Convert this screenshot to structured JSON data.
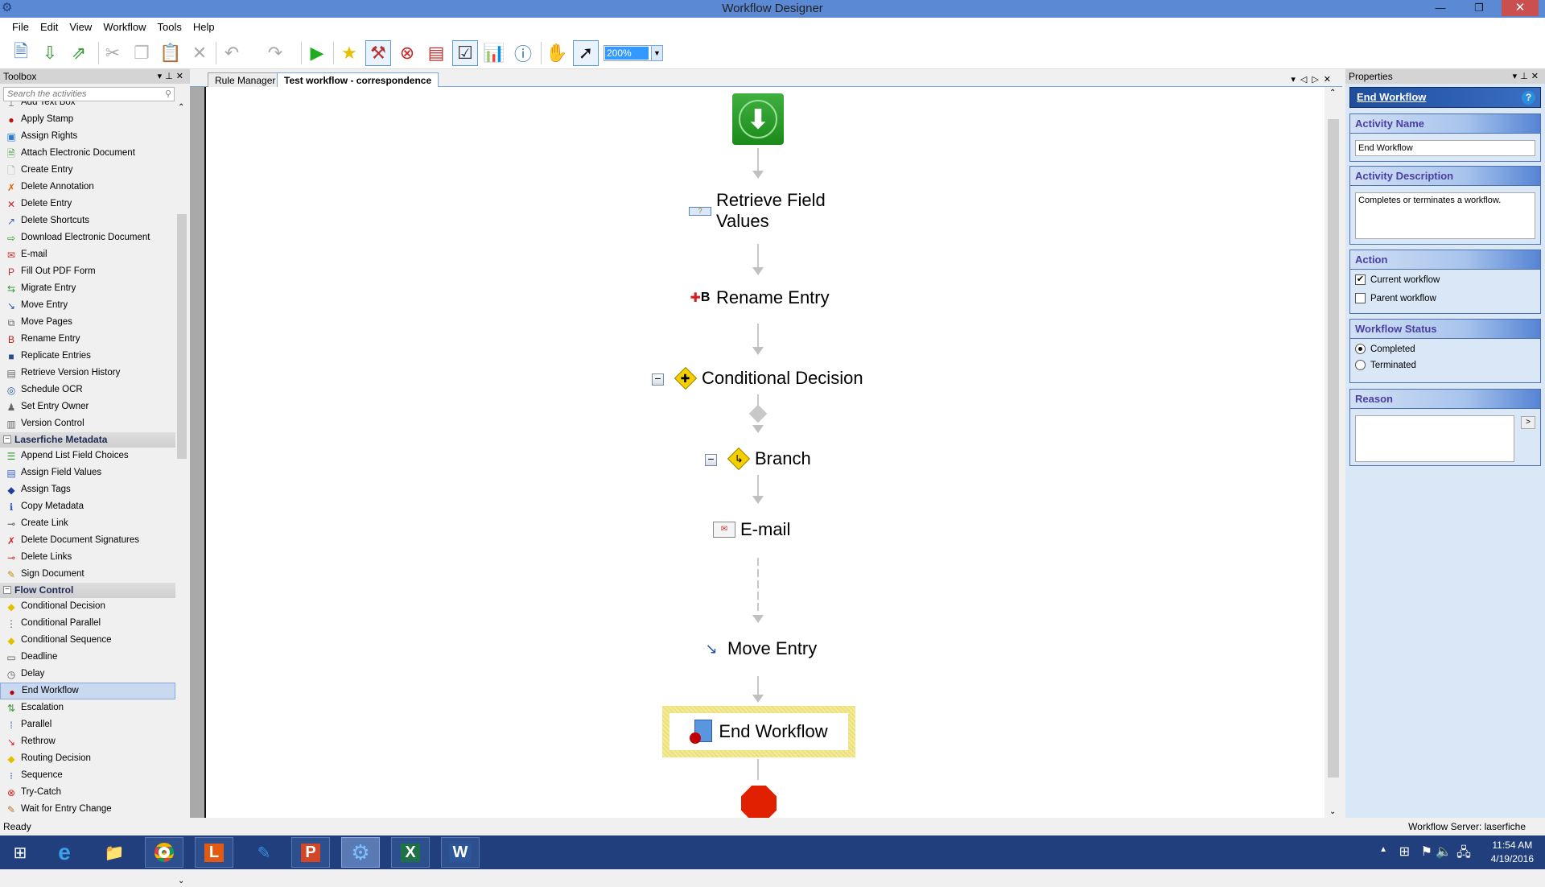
{
  "window": {
    "title": "Workflow Designer",
    "controls": {
      "minimize": "—",
      "restore": "❐",
      "close": "✕"
    }
  },
  "menu": [
    "File",
    "Edit",
    "View",
    "Workflow",
    "Tools",
    "Help"
  ],
  "toolbar": {
    "buttons": [
      {
        "name": "new-workflow",
        "icon": "new-workflow-icon"
      },
      {
        "name": "open-workflow",
        "icon": "open-workflow-icon"
      },
      {
        "name": "publish-workflow",
        "icon": "publish-workflow-icon"
      },
      {
        "name": "cut",
        "icon": "scissors-icon"
      },
      {
        "name": "copy",
        "icon": "copy-icon"
      },
      {
        "name": "paste",
        "icon": "paste-icon"
      },
      {
        "name": "delete",
        "icon": "delete-icon"
      },
      {
        "name": "undo",
        "icon": "undo-icon"
      },
      {
        "name": "redo",
        "icon": "redo-icon"
      },
      {
        "name": "run",
        "icon": "play-icon"
      },
      {
        "name": "find-starting-rules",
        "icon": "search-star-icon"
      },
      {
        "name": "tools",
        "icon": "tools-icon"
      },
      {
        "name": "errors",
        "icon": "error-icon"
      },
      {
        "name": "outline",
        "icon": "outline-icon"
      },
      {
        "name": "checklist",
        "icon": "checklist-icon"
      },
      {
        "name": "reports",
        "icon": "bar-chart-icon"
      },
      {
        "name": "workflow-info",
        "icon": "info-icon"
      },
      {
        "name": "pan",
        "icon": "hand-icon"
      },
      {
        "name": "select",
        "icon": "pointer-icon"
      }
    ],
    "zoom": "200%"
  },
  "toolbox": {
    "title": "Toolbox",
    "search_placeholder": "Search the activities",
    "items_top": [
      {
        "label": "Add Text Box",
        "icon": "text-box-icon"
      },
      {
        "label": "Apply Stamp",
        "icon": "stamp-icon"
      },
      {
        "label": "Assign Rights",
        "icon": "rights-icon"
      },
      {
        "label": "Attach Electronic Document",
        "icon": "attach-doc-icon"
      },
      {
        "label": "Create Entry",
        "icon": "new-entry-icon"
      },
      {
        "label": "Delete Annotation",
        "icon": "delete-annotation-icon"
      },
      {
        "label": "Delete Entry",
        "icon": "red-x-icon"
      },
      {
        "label": "Delete Shortcuts",
        "icon": "delete-shortcut-icon"
      },
      {
        "label": "Download Electronic Document",
        "icon": "download-doc-icon"
      },
      {
        "label": "E-mail",
        "icon": "email-icon"
      },
      {
        "label": "Fill Out PDF Form",
        "icon": "pdf-icon"
      },
      {
        "label": "Migrate Entry",
        "icon": "migrate-icon"
      },
      {
        "label": "Move Entry",
        "icon": "move-entry-icon"
      },
      {
        "label": "Move Pages",
        "icon": "move-pages-icon"
      },
      {
        "label": "Rename Entry",
        "icon": "rename-icon"
      },
      {
        "label": "Replicate Entries",
        "icon": "replicate-icon"
      },
      {
        "label": "Retrieve Version History",
        "icon": "version-history-icon"
      },
      {
        "label": "Schedule OCR",
        "icon": "ocr-icon"
      },
      {
        "label": "Set Entry Owner",
        "icon": "owner-icon"
      },
      {
        "label": "Version Control",
        "icon": "version-control-icon"
      }
    ],
    "cat_metadata": "Laserfiche Metadata",
    "items_metadata": [
      {
        "label": "Append List Field Choices",
        "icon": "list-append-icon"
      },
      {
        "label": "Assign Field Values",
        "icon": "field-values-icon"
      },
      {
        "label": "Assign Tags",
        "icon": "tag-icon"
      },
      {
        "label": "Copy Metadata",
        "icon": "copy-metadata-icon"
      },
      {
        "label": "Create Link",
        "icon": "link-icon"
      },
      {
        "label": "Delete Document Signatures",
        "icon": "delete-signature-icon"
      },
      {
        "label": "Delete Links",
        "icon": "delete-link-icon"
      },
      {
        "label": "Sign Document",
        "icon": "sign-icon"
      }
    ],
    "cat_flow": "Flow Control",
    "items_flow": [
      {
        "label": "Conditional Decision",
        "icon": "decision-icon"
      },
      {
        "label": "Conditional Parallel",
        "icon": "cond-parallel-icon"
      },
      {
        "label": "Conditional Sequence",
        "icon": "cond-sequence-icon"
      },
      {
        "label": "Deadline",
        "icon": "deadline-icon"
      },
      {
        "label": "Delay",
        "icon": "clock-icon"
      },
      {
        "label": "End Workflow",
        "icon": "end-workflow-icon",
        "selected": true
      },
      {
        "label": "Escalation",
        "icon": "escalation-icon"
      },
      {
        "label": "Parallel",
        "icon": "parallel-icon"
      },
      {
        "label": "Rethrow",
        "icon": "rethrow-icon"
      },
      {
        "label": "Routing Decision",
        "icon": "routing-icon"
      },
      {
        "label": "Sequence",
        "icon": "sequence-icon"
      },
      {
        "label": "Try-Catch",
        "icon": "try-catch-icon"
      },
      {
        "label": "Wait for Entry Change",
        "icon": "wait-icon"
      }
    ]
  },
  "tabs": [
    {
      "label": "Rule Manager",
      "active": false
    },
    {
      "label": "Test workflow - correspondence",
      "active": true
    }
  ],
  "canvas": {
    "nodes": [
      {
        "label": "Retrieve Field Values",
        "icon": "retrieve-fields-icon"
      },
      {
        "label": "Rename Entry",
        "icon": "rename-icon"
      },
      {
        "label": "Conditional Decision",
        "icon": "decision-icon"
      },
      {
        "label": "Branch",
        "icon": "branch-icon"
      },
      {
        "label": "E-mail",
        "icon": "email-icon"
      },
      {
        "label": "Move Entry",
        "icon": "move-entry-icon"
      },
      {
        "label": "End Workflow",
        "icon": "end-workflow-icon",
        "selected": true
      }
    ]
  },
  "properties": {
    "title": "Properties",
    "activity_header": "End Workflow",
    "help": "?",
    "activity_name_label": "Activity Name",
    "activity_name_value": "End Workflow",
    "activity_description_label": "Activity Description",
    "activity_description_value": "Completes or terminates a workflow.",
    "action_label": "Action",
    "action_options": [
      {
        "label": "Current workflow",
        "checked": true
      },
      {
        "label": "Parent workflow",
        "checked": false
      }
    ],
    "status_label": "Workflow Status",
    "status_options": [
      {
        "label": "Completed",
        "selected": true
      },
      {
        "label": "Terminated",
        "selected": false
      }
    ],
    "reason_label": "Reason",
    "reason_value": "",
    "reason_button": ">"
  },
  "status": {
    "left": "Ready",
    "right": "Workflow Server: laserfiche"
  },
  "taskbar": {
    "apps": [
      "start",
      "internet-explorer",
      "file-explorer",
      "chrome",
      "laserfiche",
      "pen-tool",
      "powerpoint",
      "workflow-designer",
      "excel",
      "word"
    ],
    "time": "11:54 AM",
    "date": "4/19/2016"
  }
}
